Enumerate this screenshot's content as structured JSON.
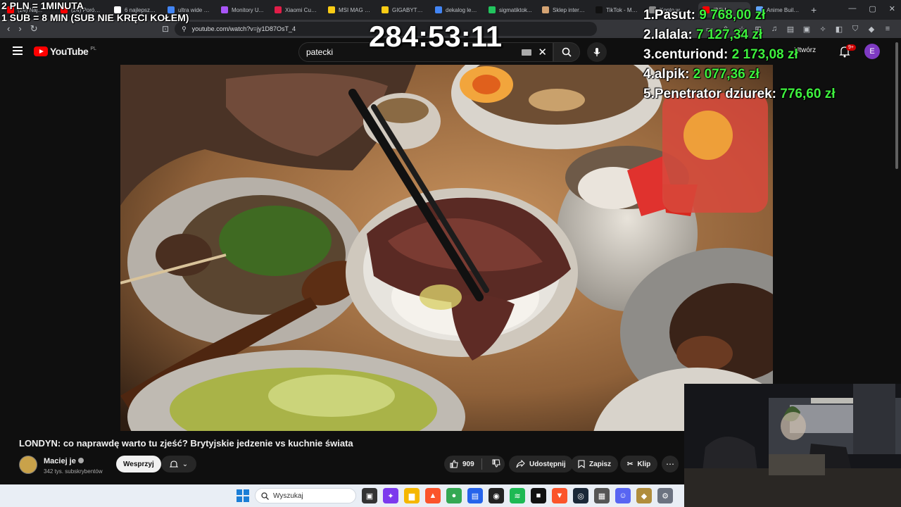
{
  "browser": {
    "tabs": [
      {
        "title": "(24) Naj...",
        "color": "#ff0000"
      },
      {
        "title": "(24) Porówn...",
        "color": "#ff0000"
      },
      {
        "title": "6 najlepszych...",
        "color": "#ffffff"
      },
      {
        "title": "ultra wide 3...",
        "color": "#4285f4"
      },
      {
        "title": "Monitory U...",
        "color": "#a855f7"
      },
      {
        "title": "Xiaomi Curv...",
        "color": "#e11d48"
      },
      {
        "title": "MSI MAG 3...",
        "color": "#facc15"
      },
      {
        "title": "GIGABYTE G...",
        "color": "#facc15"
      },
      {
        "title": "dekalog lek...",
        "color": "#4285f4"
      },
      {
        "title": "sigmatiktok...",
        "color": "#22c55e"
      },
      {
        "title": "Sklep intern...",
        "color": "#d4a373"
      },
      {
        "title": "TikTok - Ma...",
        "color": "#111111"
      },
      {
        "title": "Konto w...",
        "color": "#888888"
      },
      {
        "title": "(24) L...",
        "color": "#ff0000"
      },
      {
        "title": "Anime Build...",
        "color": "#60a5fa"
      }
    ],
    "new_tab": "+",
    "url": "youtube.com/watch?v=jy1D87OsT_4"
  },
  "youtube": {
    "logo_text": "YouTube",
    "region": "PL",
    "search_value": "patecki",
    "create_label": "Utwórz",
    "notifications_badge": "9+",
    "avatar_letter": "E"
  },
  "video": {
    "title": "LONDYN: co naprawdę warto tu zjeść? Brytyjskie jedzenie vs kuchnie świata",
    "channel": "Maciej je",
    "subscribers": "342 tys. subskrybentów",
    "support_label": "Wesprzyj",
    "likes": "909",
    "share_label": "Udostępnij",
    "save_label": "Zapisz",
    "clip_label": "Klip"
  },
  "overlay": {
    "rule_1": "2 PLN =  1MINUTA",
    "rule_2": "1 SUB = 8 MIN (SUB NIE KRĘCI KOŁEM)",
    "timer": "284:53:11",
    "leaderboard": [
      {
        "rank": "1.",
        "name": "Pasut:",
        "amount": "9 768,00 zł"
      },
      {
        "rank": "2.",
        "name": "lalala:",
        "amount": "7 127,34 zł"
      },
      {
        "rank": "3.",
        "name": "centuriond:",
        "amount": "2 173,08 zł"
      },
      {
        "rank": "4.",
        "name": "alpik:",
        "amount": "2 077,36 zł"
      },
      {
        "rank": "5.",
        "name": "Penetrator dziurek:",
        "amount": "776,60 zł"
      }
    ]
  },
  "taskbar": {
    "search_placeholder": "Wyszukaj",
    "apps": [
      {
        "name": "task-view",
        "color": "#333333",
        "glyph": "▣"
      },
      {
        "name": "copilot",
        "color": "#7c3aed",
        "glyph": "✦"
      },
      {
        "name": "explorer",
        "color": "#f5b700",
        "glyph": "▆"
      },
      {
        "name": "brave",
        "color": "#fb542b",
        "glyph": "▲"
      },
      {
        "name": "chrome",
        "color": "#34a853",
        "glyph": "●"
      },
      {
        "name": "store",
        "color": "#2563eb",
        "glyph": "▤"
      },
      {
        "name": "recorder",
        "color": "#222222",
        "glyph": "◉"
      },
      {
        "name": "spotify",
        "color": "#1db954",
        "glyph": "≋"
      },
      {
        "name": "app-dark",
        "color": "#111111",
        "glyph": "■"
      },
      {
        "name": "browser-active",
        "color": "#fb542b",
        "glyph": "▼"
      },
      {
        "name": "steam",
        "color": "#1b2838",
        "glyph": "◎"
      },
      {
        "name": "calculator",
        "color": "#555555",
        "glyph": "▦"
      },
      {
        "name": "discord",
        "color": "#5865f2",
        "glyph": "☺"
      },
      {
        "name": "league",
        "color": "#b08d3c",
        "glyph": "◆"
      },
      {
        "name": "settings",
        "color": "#6b7280",
        "glyph": "⚙"
      }
    ]
  }
}
